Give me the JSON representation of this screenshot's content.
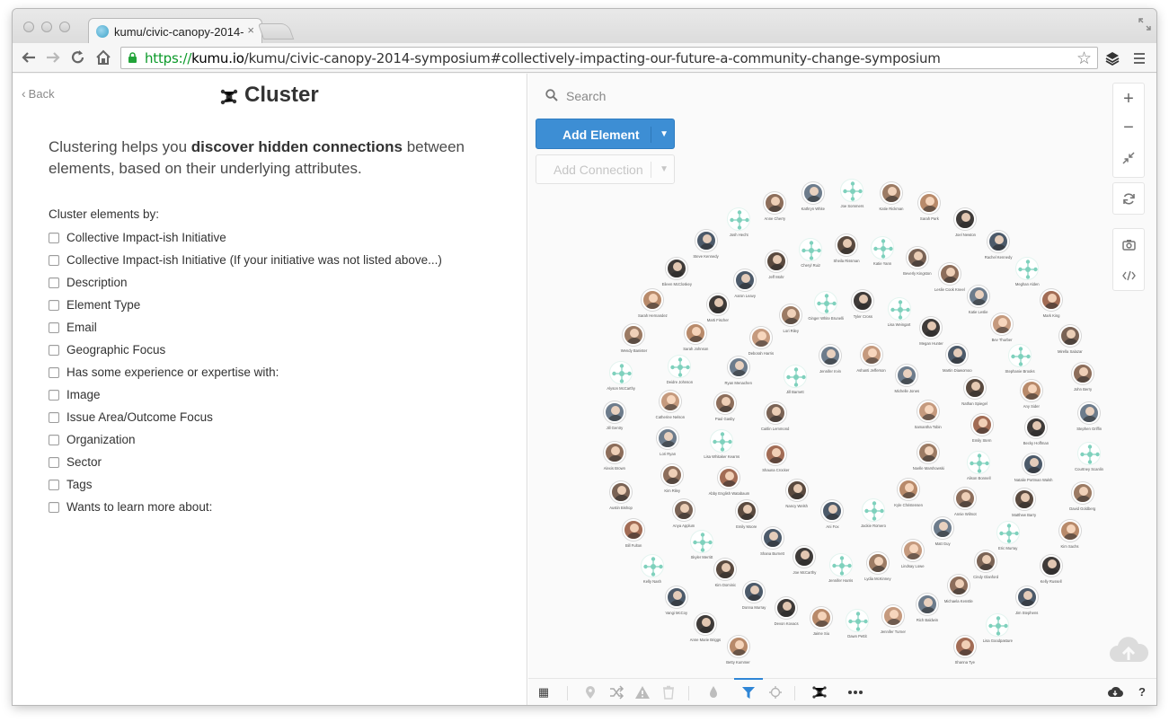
{
  "browser": {
    "tab_title": "kumu/civic-canopy-2014-",
    "tab_close": "×",
    "url_scheme": "https://",
    "url_host": "kumu.io",
    "url_path": "/kumu/civic-canopy-2014-symposium#collectively-impacting-our-future-a-community-change-symposium"
  },
  "panel": {
    "back_label": "Back",
    "title": "Cluster",
    "intro_pre": "Clustering helps you ",
    "intro_bold": "discover hidden connections",
    "intro_post": " between elements, based on their underlying attributes.",
    "cluster_by_label": "Cluster elements by:",
    "options": [
      "Collective Impact-ish Initiative",
      "Collective Impact-ish Initiative (If your initiative was not listed above...)",
      "Description",
      "Element Type",
      "Email",
      "Geographic Focus",
      "Has some experience or expertise with:",
      "Image",
      "Issue Area/Outcome Focus",
      "Organization",
      "Sector",
      "Tags",
      "Wants to learn more about:"
    ]
  },
  "map": {
    "search_placeholder": "Search",
    "add_element_label": "Add Element",
    "add_connection_label": "Add Connection",
    "node_labels": [
      "Anne Cherry",
      "Kathryn White",
      "Joe Sommers",
      "Katie Rickman",
      "Sarah Park",
      "Joel Newton",
      "Rachel Kennedy",
      "Meghan Alden",
      "Mark King",
      "Mirella Salazar",
      "John Berry",
      "Stephen Griffin",
      "Courtney Scanlin",
      "David Goldberg",
      "Kim Sachs",
      "Kelly Russell",
      "Jim Stephens",
      "Lisa Goodpasture",
      "Shanna Tye",
      "Betty Kummer",
      "Anne Marie Briggs",
      "Vangi McCoy",
      "Kelly Nash",
      "Bill Fulton",
      "Austin Bishop",
      "Alexis Brown",
      "Jill Gentry",
      "Alyson McCarthy",
      "Wendy Banister",
      "Sarah Hernandez",
      "Eileen McCloskey",
      "Steve Kennedy",
      "Josh Hecht",
      "Sheila Rissman",
      "Katie Yann",
      "Beverly Kingston",
      "Leslie Cook Kneel",
      "Katie Leslie",
      "Bev Thurber",
      "Stephanie Brooks",
      "Any Sider",
      "Becky Hoffman",
      "Natalie Portman Walsh",
      "Matthew Barry",
      "Eric Murray",
      "Cindy Glanford",
      "Michaela Kenstle",
      "Rich Baldwin",
      "Jennifer Turner",
      "Dawn Pettit",
      "Jaime Siu",
      "Devon Kovacs",
      "Donna Murray",
      "Kim Dominic",
      "Skyler Merritt",
      "Anya Applum",
      "Kim Riley",
      "Lori Ryan",
      "Catherine Nelson",
      "Deidre Johnson",
      "Sarah Johnson",
      "Marti Fischer",
      "Aaron Leavy",
      "Jeff Mohr",
      "Cheryl Ruiz",
      "Lisa Weingart",
      "Megan Hunter",
      "Martin Diawomoo",
      "Nathan Spiegel",
      "Emily Stern",
      "Alison Bonnell",
      "Annie Wilmot",
      "Matt Guy",
      "Lindsay Lowe",
      "Lydia McKinney",
      "Jennifer Harris",
      "Joe McCarthy",
      "Shana Burnett",
      "Emily Moore",
      "Abby English Watabaum",
      "Lisa Whitaker Kearns",
      "Paul Gasby",
      "Ryan Menachen",
      "Deborah Harris",
      "Lori Riley",
      "Ginger White Brunelli",
      "Tyler Cross",
      "Michelle Jones",
      "Samantha Tobin",
      "Noelle Marshowski",
      "Kyle Christensen",
      "Jackie Romero",
      "Ani Fox",
      "Nancy Welsh",
      "Shauna Crocker",
      "Caitlin Lemmond",
      "Jill Barnett",
      "Jennifer Irvin",
      "Ashanti Jefferson",
      "Drew O'Connor",
      "Amy Welch",
      "Diana Woodworth-Jordan",
      "Roberto Montoya",
      "Jameen Mackenzie-Wu",
      "Vivian Lu"
    ]
  },
  "colors": {
    "accent": "#3d8ed4",
    "teal_node": "#7fd1bd",
    "url_scheme": "#0c9a2a"
  }
}
